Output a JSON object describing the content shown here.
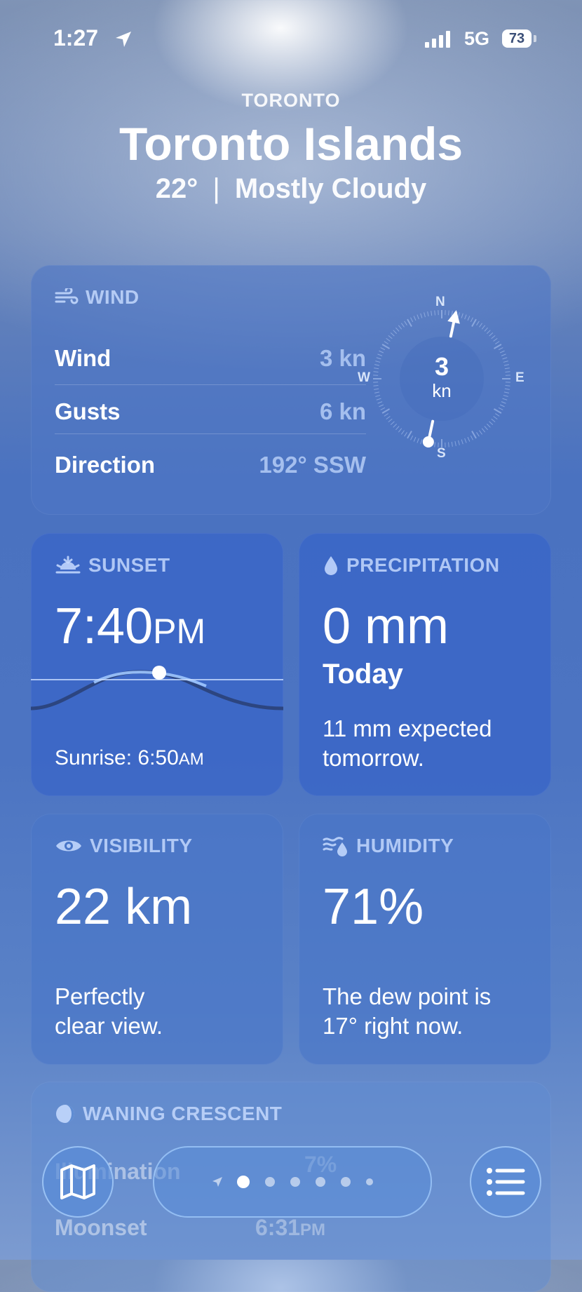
{
  "status_bar": {
    "time": "1:27",
    "network": "5G",
    "battery": "73"
  },
  "header": {
    "city_small": "TORONTO",
    "location": "Toronto Islands",
    "temperature": "22°",
    "separator": "|",
    "condition": "Mostly Cloudy"
  },
  "wind": {
    "title": "WIND",
    "rows": [
      {
        "label": "Wind",
        "value": "3 kn"
      },
      {
        "label": "Gusts",
        "value": "6 kn"
      },
      {
        "label": "Direction",
        "value": "192° SSW"
      }
    ],
    "compass": {
      "n": "N",
      "e": "E",
      "s": "S",
      "w": "W",
      "speed": "3",
      "unit": "kn",
      "direction_degrees": 192
    }
  },
  "sunset": {
    "title": "SUNSET",
    "time": "7:40",
    "ampm": "PM",
    "sunrise_label": "Sunrise: 6:50",
    "sunrise_ampm": "AM"
  },
  "precipitation": {
    "title": "PRECIPITATION",
    "amount": "0 mm",
    "period": "Today",
    "forecast_line1": "11 mm expected",
    "forecast_line2": "tomorrow."
  },
  "visibility": {
    "title": "VISIBILITY",
    "value": "22 km",
    "line1": "Perfectly",
    "line2": "clear view."
  },
  "humidity": {
    "title": "HUMIDITY",
    "value": "71%",
    "line1": "The dew point is",
    "line2": "17° right now."
  },
  "moon": {
    "title": "WANING CRESCENT",
    "row1_label": "Illumination",
    "row1_value": "7%",
    "row2_label": "Moonset",
    "row2_value": "6:31",
    "row2_ampm": "PM"
  },
  "pager": {
    "pages": 7,
    "current": 2
  },
  "icons": {
    "map": "map-icon",
    "list": "list-icon",
    "location": "location-arrow-icon"
  }
}
